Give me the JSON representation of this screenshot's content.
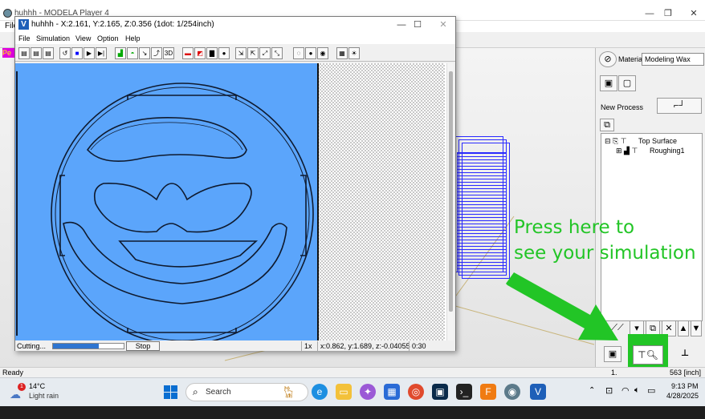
{
  "main_window": {
    "title": "huhhh - MODELA Player 4",
    "menu_first": "File",
    "pe_tag": "Pe",
    "status": "Ready",
    "coord_left": "1.",
    "coord_right": "563 [inch]"
  },
  "right_panel": {
    "material_label": "Material",
    "material_value": "Modeling Wax",
    "new_process_label": "New Process",
    "tree": {
      "root": "Top Surface",
      "child": "Roughing1"
    }
  },
  "annotation": {
    "line1": "Press here to",
    "line2": "see your simulation",
    "color": "#22c526"
  },
  "sim_window": {
    "title": "huhhh - X:2.161, Y:2.165, Z:0.356 (1dot: 1/254inch)",
    "menu": [
      "File",
      "Simulation",
      "View",
      "Option",
      "Help"
    ],
    "status_cutting": "Cutting...",
    "progress_fraction": 0.65,
    "stop_label": "Stop",
    "zoom": "1x",
    "coords": "x:0.862, y:1.689, z:-0.04055",
    "time": "0:30",
    "workpiece_color": "#5ba5fb"
  },
  "taskbar": {
    "weather_temp": "14°C",
    "weather_desc": "Light rain",
    "search_placeholder": "Search",
    "time": "9:13 PM",
    "date": "4/28/2025"
  }
}
